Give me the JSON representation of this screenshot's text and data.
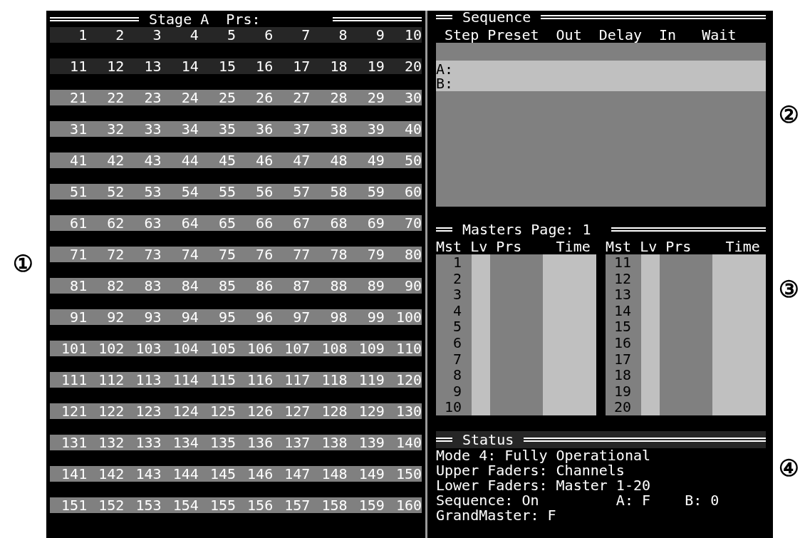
{
  "annotations": [
    "①",
    "②",
    "③",
    "④"
  ],
  "stage_presets": {
    "title": "Stage A  Prs:",
    "rows": [
      {
        "color": "#262626",
        "cells": [
          "1",
          "2",
          "3",
          "4",
          "5",
          "6",
          "7",
          "8",
          "9",
          "10"
        ]
      },
      {
        "color": "#262626",
        "cells": [
          "11",
          "12",
          "13",
          "14",
          "15",
          "16",
          "17",
          "18",
          "19",
          "20"
        ]
      },
      {
        "color": "#808080",
        "cells": [
          "21",
          "22",
          "23",
          "24",
          "25",
          "26",
          "27",
          "28",
          "29",
          "30"
        ]
      },
      {
        "color": "#808080",
        "cells": [
          "31",
          "32",
          "33",
          "34",
          "35",
          "36",
          "37",
          "38",
          "39",
          "40"
        ]
      },
      {
        "color": "#808080",
        "cells": [
          "41",
          "42",
          "43",
          "44",
          "45",
          "46",
          "47",
          "48",
          "49",
          "50"
        ]
      },
      {
        "color": "#808080",
        "cells": [
          "51",
          "52",
          "53",
          "54",
          "55",
          "56",
          "57",
          "58",
          "59",
          "60"
        ]
      },
      {
        "color": "#808080",
        "cells": [
          "61",
          "62",
          "63",
          "64",
          "65",
          "66",
          "67",
          "68",
          "69",
          "70"
        ]
      },
      {
        "color": "#808080",
        "cells": [
          "71",
          "72",
          "73",
          "74",
          "75",
          "76",
          "77",
          "78",
          "79",
          "80"
        ]
      },
      {
        "color": "#808080",
        "cells": [
          "81",
          "82",
          "83",
          "84",
          "85",
          "86",
          "87",
          "88",
          "89",
          "90"
        ]
      },
      {
        "color": "#808080",
        "cells": [
          "91",
          "92",
          "93",
          "94",
          "95",
          "96",
          "97",
          "98",
          "99",
          "100"
        ]
      },
      {
        "color": "#808080",
        "cells": [
          "101",
          "102",
          "103",
          "104",
          "105",
          "106",
          "107",
          "108",
          "109",
          "110"
        ]
      },
      {
        "color": "#808080",
        "cells": [
          "111",
          "112",
          "113",
          "114",
          "115",
          "116",
          "117",
          "118",
          "119",
          "120"
        ]
      },
      {
        "color": "#808080",
        "cells": [
          "121",
          "122",
          "123",
          "124",
          "125",
          "126",
          "127",
          "128",
          "129",
          "130"
        ]
      },
      {
        "color": "#808080",
        "cells": [
          "131",
          "132",
          "133",
          "134",
          "135",
          "136",
          "137",
          "138",
          "139",
          "140"
        ]
      },
      {
        "color": "#808080",
        "cells": [
          "141",
          "142",
          "143",
          "144",
          "145",
          "146",
          "147",
          "148",
          "149",
          "150"
        ]
      },
      {
        "color": "#808080",
        "cells": [
          "151",
          "152",
          "153",
          "154",
          "155",
          "156",
          "157",
          "158",
          "159",
          "160"
        ]
      }
    ]
  },
  "sequence": {
    "title": "Sequence",
    "columns": [
      "Step",
      "Preset",
      "Out",
      "Delay",
      "In",
      "Wait"
    ],
    "playbacks": [
      "A:",
      "B:"
    ]
  },
  "masters": {
    "title": "Masters Page: 1",
    "tables": [
      {
        "columns": [
          "Mst",
          "Lv",
          "Prs",
          "Time"
        ],
        "rows": [
          "1",
          "2",
          "3",
          "4",
          "5",
          "6",
          "7",
          "8",
          "9",
          "10"
        ]
      },
      {
        "columns": [
          "Mst",
          "Lv",
          "Prs",
          "Time"
        ],
        "rows": [
          "11",
          "12",
          "13",
          "14",
          "15",
          "16",
          "17",
          "18",
          "19",
          "20"
        ]
      }
    ]
  },
  "status": {
    "title": "Status",
    "lines": [
      [
        "Mode 4: Fully Operational"
      ],
      [
        "Upper Faders: Channels"
      ],
      [
        "Lower Faders: Master 1-20"
      ],
      [
        "Sequence: On",
        "A: F",
        "B: 0"
      ],
      [
        "GrandMaster: F"
      ]
    ]
  }
}
